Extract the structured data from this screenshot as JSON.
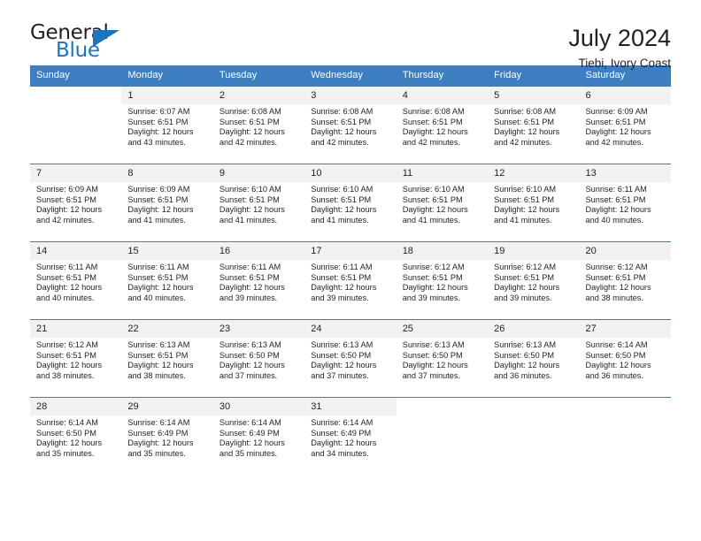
{
  "brand": {
    "name_part1": "General",
    "name_part2": "Blue",
    "accent_color": "#1b75bc"
  },
  "header": {
    "title": "July 2024",
    "subtitle": "Tiebi, Ivory Coast"
  },
  "calendar": {
    "header_bg": "#3c7ebf",
    "daynum_bg": "#f2f2f2",
    "weekdays": [
      "Sunday",
      "Monday",
      "Tuesday",
      "Wednesday",
      "Thursday",
      "Friday",
      "Saturday"
    ],
    "weeks": [
      [
        {
          "day": "",
          "sunrise": "",
          "sunset": "",
          "daylight_line1": "",
          "daylight_line2": ""
        },
        {
          "day": "1",
          "sunrise": "Sunrise: 6:07 AM",
          "sunset": "Sunset: 6:51 PM",
          "daylight_line1": "Daylight: 12 hours",
          "daylight_line2": "and 43 minutes."
        },
        {
          "day": "2",
          "sunrise": "Sunrise: 6:08 AM",
          "sunset": "Sunset: 6:51 PM",
          "daylight_line1": "Daylight: 12 hours",
          "daylight_line2": "and 42 minutes."
        },
        {
          "day": "3",
          "sunrise": "Sunrise: 6:08 AM",
          "sunset": "Sunset: 6:51 PM",
          "daylight_line1": "Daylight: 12 hours",
          "daylight_line2": "and 42 minutes."
        },
        {
          "day": "4",
          "sunrise": "Sunrise: 6:08 AM",
          "sunset": "Sunset: 6:51 PM",
          "daylight_line1": "Daylight: 12 hours",
          "daylight_line2": "and 42 minutes."
        },
        {
          "day": "5",
          "sunrise": "Sunrise: 6:08 AM",
          "sunset": "Sunset: 6:51 PM",
          "daylight_line1": "Daylight: 12 hours",
          "daylight_line2": "and 42 minutes."
        },
        {
          "day": "6",
          "sunrise": "Sunrise: 6:09 AM",
          "sunset": "Sunset: 6:51 PM",
          "daylight_line1": "Daylight: 12 hours",
          "daylight_line2": "and 42 minutes."
        }
      ],
      [
        {
          "day": "7",
          "sunrise": "Sunrise: 6:09 AM",
          "sunset": "Sunset: 6:51 PM",
          "daylight_line1": "Daylight: 12 hours",
          "daylight_line2": "and 42 minutes."
        },
        {
          "day": "8",
          "sunrise": "Sunrise: 6:09 AM",
          "sunset": "Sunset: 6:51 PM",
          "daylight_line1": "Daylight: 12 hours",
          "daylight_line2": "and 41 minutes."
        },
        {
          "day": "9",
          "sunrise": "Sunrise: 6:10 AM",
          "sunset": "Sunset: 6:51 PM",
          "daylight_line1": "Daylight: 12 hours",
          "daylight_line2": "and 41 minutes."
        },
        {
          "day": "10",
          "sunrise": "Sunrise: 6:10 AM",
          "sunset": "Sunset: 6:51 PM",
          "daylight_line1": "Daylight: 12 hours",
          "daylight_line2": "and 41 minutes."
        },
        {
          "day": "11",
          "sunrise": "Sunrise: 6:10 AM",
          "sunset": "Sunset: 6:51 PM",
          "daylight_line1": "Daylight: 12 hours",
          "daylight_line2": "and 41 minutes."
        },
        {
          "day": "12",
          "sunrise": "Sunrise: 6:10 AM",
          "sunset": "Sunset: 6:51 PM",
          "daylight_line1": "Daylight: 12 hours",
          "daylight_line2": "and 41 minutes."
        },
        {
          "day": "13",
          "sunrise": "Sunrise: 6:11 AM",
          "sunset": "Sunset: 6:51 PM",
          "daylight_line1": "Daylight: 12 hours",
          "daylight_line2": "and 40 minutes."
        }
      ],
      [
        {
          "day": "14",
          "sunrise": "Sunrise: 6:11 AM",
          "sunset": "Sunset: 6:51 PM",
          "daylight_line1": "Daylight: 12 hours",
          "daylight_line2": "and 40 minutes."
        },
        {
          "day": "15",
          "sunrise": "Sunrise: 6:11 AM",
          "sunset": "Sunset: 6:51 PM",
          "daylight_line1": "Daylight: 12 hours",
          "daylight_line2": "and 40 minutes."
        },
        {
          "day": "16",
          "sunrise": "Sunrise: 6:11 AM",
          "sunset": "Sunset: 6:51 PM",
          "daylight_line1": "Daylight: 12 hours",
          "daylight_line2": "and 39 minutes."
        },
        {
          "day": "17",
          "sunrise": "Sunrise: 6:11 AM",
          "sunset": "Sunset: 6:51 PM",
          "daylight_line1": "Daylight: 12 hours",
          "daylight_line2": "and 39 minutes."
        },
        {
          "day": "18",
          "sunrise": "Sunrise: 6:12 AM",
          "sunset": "Sunset: 6:51 PM",
          "daylight_line1": "Daylight: 12 hours",
          "daylight_line2": "and 39 minutes."
        },
        {
          "day": "19",
          "sunrise": "Sunrise: 6:12 AM",
          "sunset": "Sunset: 6:51 PM",
          "daylight_line1": "Daylight: 12 hours",
          "daylight_line2": "and 39 minutes."
        },
        {
          "day": "20",
          "sunrise": "Sunrise: 6:12 AM",
          "sunset": "Sunset: 6:51 PM",
          "daylight_line1": "Daylight: 12 hours",
          "daylight_line2": "and 38 minutes."
        }
      ],
      [
        {
          "day": "21",
          "sunrise": "Sunrise: 6:12 AM",
          "sunset": "Sunset: 6:51 PM",
          "daylight_line1": "Daylight: 12 hours",
          "daylight_line2": "and 38 minutes."
        },
        {
          "day": "22",
          "sunrise": "Sunrise: 6:13 AM",
          "sunset": "Sunset: 6:51 PM",
          "daylight_line1": "Daylight: 12 hours",
          "daylight_line2": "and 38 minutes."
        },
        {
          "day": "23",
          "sunrise": "Sunrise: 6:13 AM",
          "sunset": "Sunset: 6:50 PM",
          "daylight_line1": "Daylight: 12 hours",
          "daylight_line2": "and 37 minutes."
        },
        {
          "day": "24",
          "sunrise": "Sunrise: 6:13 AM",
          "sunset": "Sunset: 6:50 PM",
          "daylight_line1": "Daylight: 12 hours",
          "daylight_line2": "and 37 minutes."
        },
        {
          "day": "25",
          "sunrise": "Sunrise: 6:13 AM",
          "sunset": "Sunset: 6:50 PM",
          "daylight_line1": "Daylight: 12 hours",
          "daylight_line2": "and 37 minutes."
        },
        {
          "day": "26",
          "sunrise": "Sunrise: 6:13 AM",
          "sunset": "Sunset: 6:50 PM",
          "daylight_line1": "Daylight: 12 hours",
          "daylight_line2": "and 36 minutes."
        },
        {
          "day": "27",
          "sunrise": "Sunrise: 6:14 AM",
          "sunset": "Sunset: 6:50 PM",
          "daylight_line1": "Daylight: 12 hours",
          "daylight_line2": "and 36 minutes."
        }
      ],
      [
        {
          "day": "28",
          "sunrise": "Sunrise: 6:14 AM",
          "sunset": "Sunset: 6:50 PM",
          "daylight_line1": "Daylight: 12 hours",
          "daylight_line2": "and 35 minutes."
        },
        {
          "day": "29",
          "sunrise": "Sunrise: 6:14 AM",
          "sunset": "Sunset: 6:49 PM",
          "daylight_line1": "Daylight: 12 hours",
          "daylight_line2": "and 35 minutes."
        },
        {
          "day": "30",
          "sunrise": "Sunrise: 6:14 AM",
          "sunset": "Sunset: 6:49 PM",
          "daylight_line1": "Daylight: 12 hours",
          "daylight_line2": "and 35 minutes."
        },
        {
          "day": "31",
          "sunrise": "Sunrise: 6:14 AM",
          "sunset": "Sunset: 6:49 PM",
          "daylight_line1": "Daylight: 12 hours",
          "daylight_line2": "and 34 minutes."
        },
        {
          "day": "",
          "sunrise": "",
          "sunset": "",
          "daylight_line1": "",
          "daylight_line2": ""
        },
        {
          "day": "",
          "sunrise": "",
          "sunset": "",
          "daylight_line1": "",
          "daylight_line2": ""
        },
        {
          "day": "",
          "sunrise": "",
          "sunset": "",
          "daylight_line1": "",
          "daylight_line2": ""
        }
      ]
    ]
  }
}
